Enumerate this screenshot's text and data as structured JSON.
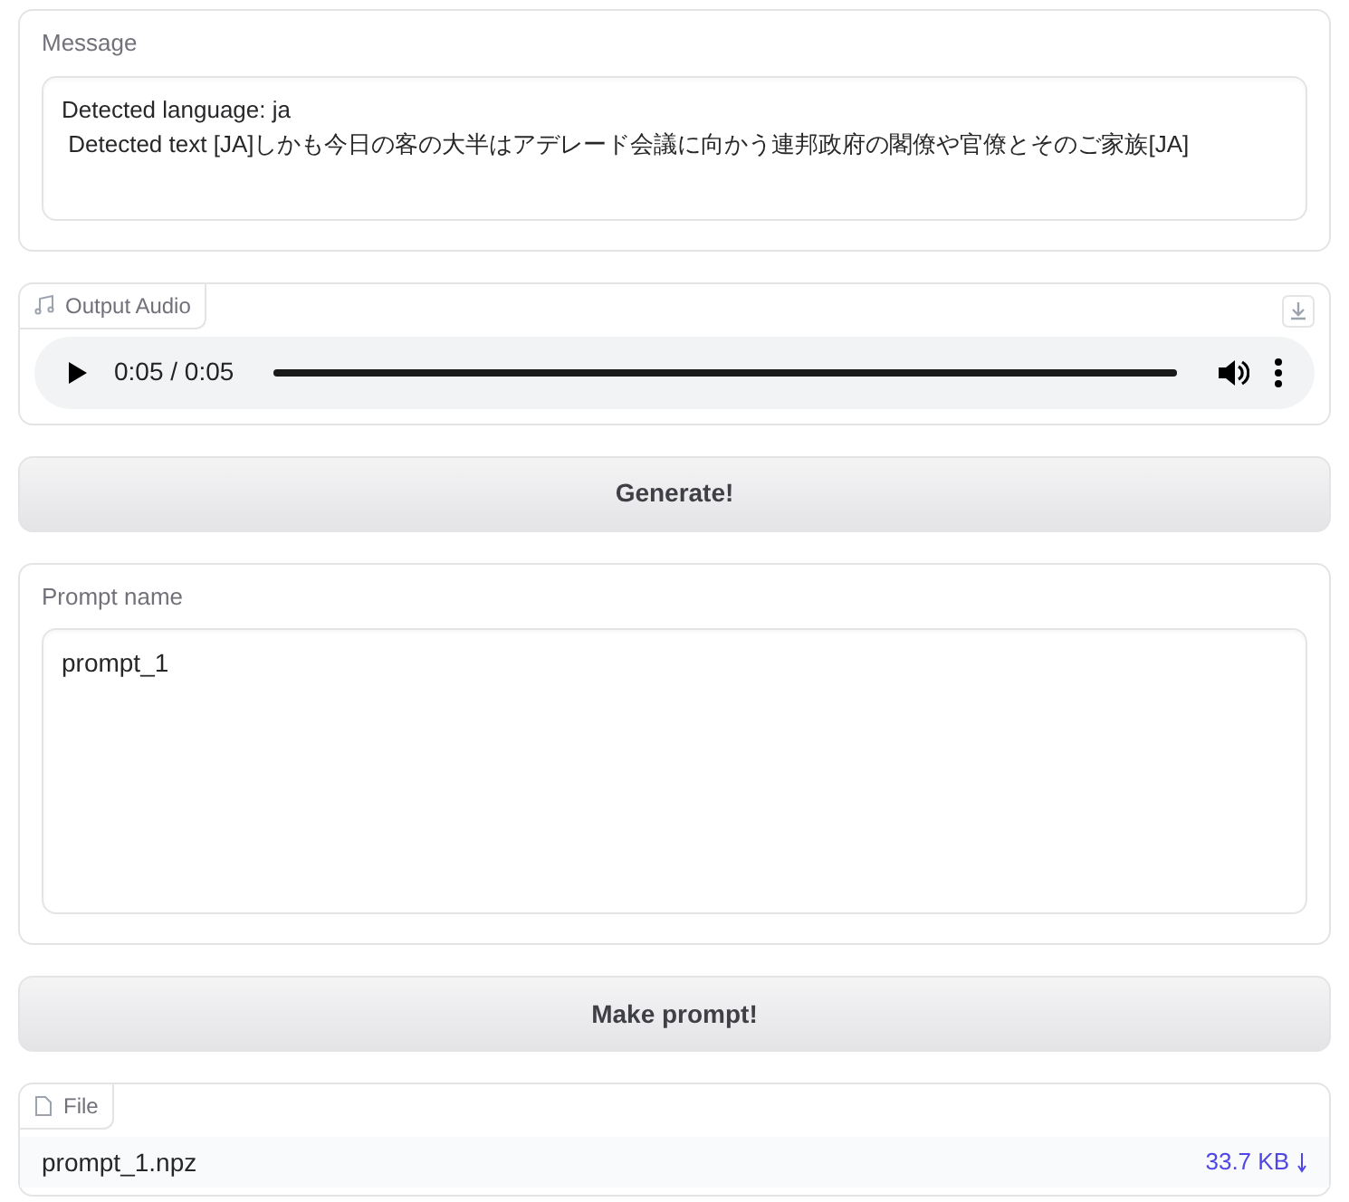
{
  "message": {
    "label": "Message",
    "lines": [
      "Detected language: ja",
      " Detected text [JA]しかも今日の客の大半はアデレード会議に向かう連邦政府の閣僚や官僚とそのご家族[JA]"
    ]
  },
  "output_audio": {
    "label": "Output Audio",
    "time": "0:05 / 0:05",
    "level": 1.0
  },
  "generate_button": "Generate!",
  "prompt_name": {
    "label": "Prompt name",
    "value": "prompt_1"
  },
  "make_prompt_button": "Make prompt!",
  "file": {
    "label": "File",
    "name": "prompt_1.npz",
    "size": "33.7 KB"
  }
}
